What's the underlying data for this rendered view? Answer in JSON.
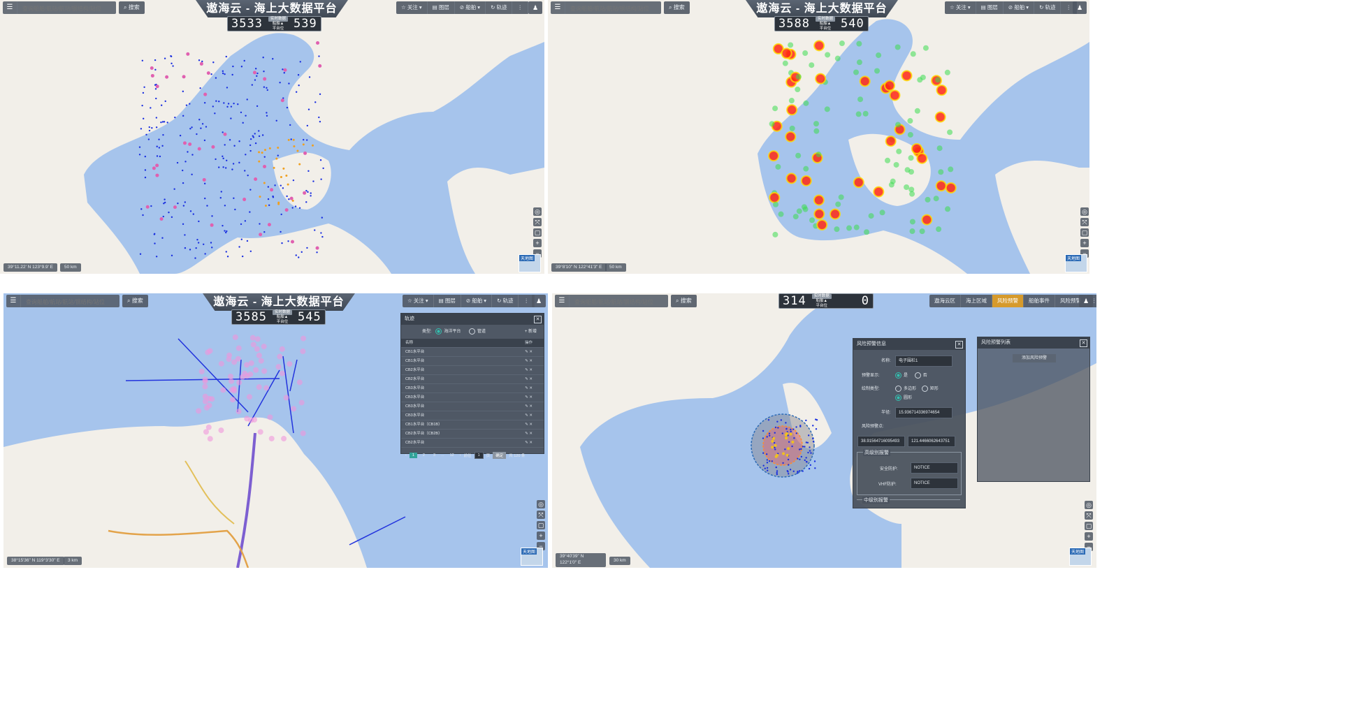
{
  "app_title": "遨海云 - 海上大数据平台",
  "search": {
    "placeholder": "查询船舶/航站/航站/钢结构/站位"
  },
  "search_button": "搜索",
  "toolbar": [
    "关注",
    "图层",
    "船舶",
    "轨迹"
  ],
  "counter_labels": {
    "realtime": "实时数据",
    "ships": "船舶▲",
    "platforms": "平台位"
  },
  "panels": [
    {
      "ships": "3533",
      "platforms": "539",
      "coord": "39°11.22' N 123°9.9' E",
      "scale": "50 km"
    },
    {
      "ships": "3588",
      "platforms": "540",
      "coord": "39°8'10\" N 122°41'3\" E",
      "scale": "50 km"
    },
    {
      "ships": "3585",
      "platforms": "545",
      "coord": "38°15'36\" N 119°3'30\" E",
      "scale": "3 km"
    },
    {
      "ships": "314",
      "platforms": "0",
      "coord": "39°40'39\" N 122°1'0\" E",
      "scale": "30 km"
    }
  ],
  "map_badge": "天地图",
  "panel4_toolbar": [
    "遨海云区",
    "海上区域",
    "风险预警",
    "船舶事件",
    "风险预警"
  ],
  "track_dialog": {
    "title": "轨迹",
    "type_label": "类型:",
    "type_options": [
      "海洋平台",
      "管道"
    ],
    "add_label": "+ 新增",
    "columns": [
      "名称",
      "操作"
    ],
    "rows": [
      "CB1水平台",
      "CB1水平台",
      "CB2水平台",
      "CB2水平台",
      "CB3水平台",
      "CB3水平台",
      "CB3水平台",
      "CB3水平台",
      "CB1水平台（CB1B）",
      "CB2水平台（CB2B）",
      "CB2水平台"
    ],
    "pager": [
      "1",
      "2",
      "3",
      "...",
      "12",
      "前往",
      "1",
      "页",
      "确定",
      "共 120 条"
    ]
  },
  "warn_dialog": {
    "title": "风险预警信息",
    "name_label": "名称:",
    "name_value": "电子围栏1",
    "show_label": "预警显示:",
    "show_options": [
      "是",
      "否"
    ],
    "shape_label": "绘制类型:",
    "shape_options": [
      "多边形",
      "矩形",
      "圆形"
    ],
    "radius_label": "半径:",
    "radius_value": "15.936714336974654",
    "center_label": "风险预警点:",
    "lat": "38.91564716095493",
    "lon": "121.4466062643751",
    "high_level": "高级别报警",
    "safe_label": "安全防护:",
    "safe_value": "NOTICE",
    "vhf_label": "VHF防护:",
    "vhf_value": "NOTICE",
    "mid_level": "中级别报警"
  },
  "list_dialog": {
    "title": "风险预警列表",
    "add_btn": "添加风险预警"
  },
  "colors": {
    "sea": "#a6c4ec",
    "land": "#f2efe9",
    "ui": "#505864"
  }
}
